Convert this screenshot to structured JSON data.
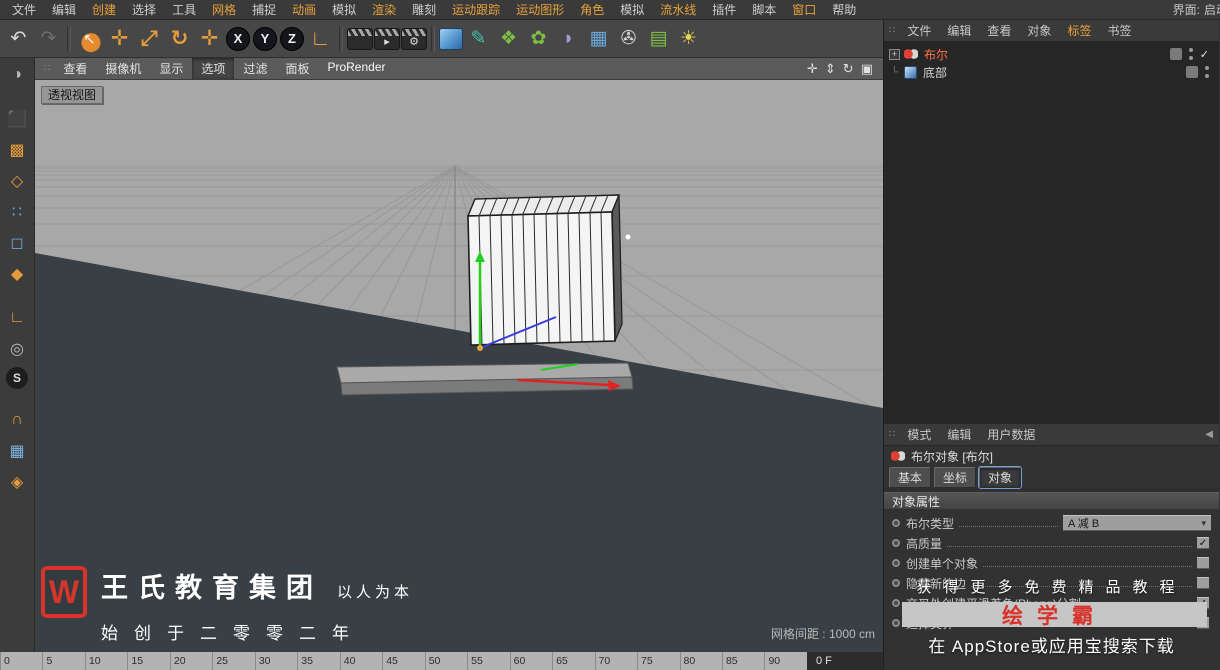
{
  "colors": {
    "accent_orange": "#e8a23b",
    "boole_text": "#ff7043",
    "brand_red": "#d6352b",
    "axis_x": "#e02222",
    "axis_y": "#21cf21",
    "axis_z": "#3b3be0"
  },
  "glyphs": {
    "plus": "+",
    "collapse": "◀",
    "check": "✓",
    "dropdown_arrow": "▾",
    "handle": "∷",
    "tree_child": "└"
  },
  "menubar": {
    "items": [
      {
        "label": "文件",
        "cls": ""
      },
      {
        "label": "编辑",
        "cls": ""
      },
      {
        "label": "创建",
        "cls": "accent"
      },
      {
        "label": "选择",
        "cls": ""
      },
      {
        "label": "工具",
        "cls": ""
      },
      {
        "label": "网格",
        "cls": "accent"
      },
      {
        "label": "捕捉",
        "cls": ""
      },
      {
        "label": "动画",
        "cls": "accent"
      },
      {
        "label": "模拟",
        "cls": ""
      },
      {
        "label": "渲染",
        "cls": "accent"
      },
      {
        "label": "雕刻",
        "cls": ""
      },
      {
        "label": "运动跟踪",
        "cls": "accent"
      },
      {
        "label": "运动图形",
        "cls": "accent"
      },
      {
        "label": "角色",
        "cls": "accent"
      },
      {
        "label": "模拟",
        "cls": ""
      },
      {
        "label": "流水线",
        "cls": "accent"
      },
      {
        "label": "插件",
        "cls": ""
      },
      {
        "label": "脚本",
        "cls": ""
      },
      {
        "label": "窗口",
        "cls": "accent"
      },
      {
        "label": "帮助",
        "cls": ""
      }
    ],
    "interface_label": "界面:",
    "interface_value": "启动"
  },
  "toolbar": {
    "tools": [
      {
        "name": "undo-icon",
        "glyph": "↶",
        "cls": "t-light"
      },
      {
        "name": "redo-icon",
        "glyph": "↷",
        "cls": "t-dim"
      },
      {
        "name": "separator",
        "glyph": "",
        "cls": "sep"
      },
      {
        "name": "live-selection-icon",
        "glyph": "↖",
        "cls": "t-select"
      },
      {
        "name": "move-tool-icon",
        "glyph": "✛",
        "cls": "t-accent"
      },
      {
        "name": "scale-tool-icon",
        "glyph": "⤢",
        "cls": "t-accent"
      },
      {
        "name": "rotate-tool-icon",
        "glyph": "↻",
        "cls": "t-accent"
      },
      {
        "name": "recent-tool-icon",
        "glyph": "✛",
        "cls": "t-accent"
      },
      {
        "name": "x-axis-lock-icon",
        "glyph": "X",
        "cls": "t-axis"
      },
      {
        "name": "y-axis-lock-icon",
        "glyph": "Y",
        "cls": "t-axis"
      },
      {
        "name": "z-axis-lock-icon",
        "glyph": "Z",
        "cls": "t-axis"
      },
      {
        "name": "coord-system-icon",
        "glyph": "∟",
        "cls": "t-accent"
      },
      {
        "name": "separator",
        "glyph": "",
        "cls": "sep"
      },
      {
        "name": "render-view-icon",
        "glyph": "",
        "cls": "t-clapper"
      },
      {
        "name": "render-picture-viewer-icon",
        "glyph": "▸",
        "cls": "t-clapper"
      },
      {
        "name": "render-settings-icon",
        "glyph": "⚙",
        "cls": "t-clapper"
      },
      {
        "name": "separator",
        "glyph": "",
        "cls": "sep"
      },
      {
        "name": "cube-primitive-icon",
        "glyph": "",
        "cls": "t-cube"
      },
      {
        "name": "spline-pen-icon",
        "glyph": "✎",
        "cls": "t-teal"
      },
      {
        "name": "mograph-cloner-icon",
        "glyph": "❖",
        "cls": "t-green"
      },
      {
        "name": "field-icon",
        "glyph": "✿",
        "cls": "t-green"
      },
      {
        "name": "deformer-icon",
        "glyph": "◗",
        "cls": "t-purple"
      },
      {
        "name": "volume-icon",
        "glyph": "▦",
        "cls": "t-blue"
      },
      {
        "name": "camera-icon",
        "glyph": "✇",
        "cls": "t-light"
      },
      {
        "name": "display-toggle-icon",
        "glyph": "▤",
        "cls": "t-green"
      },
      {
        "name": "light-icon",
        "glyph": "☀",
        "cls": "t-yellow"
      }
    ]
  },
  "left_toolbar": {
    "tools": [
      {
        "name": "make-editable-icon",
        "glyph": "◑",
        "cls": "li-gray"
      },
      {
        "name": "model-mode-icon",
        "glyph": "⬛",
        "cls": "li-blue gap"
      },
      {
        "name": "texture-mode-icon",
        "glyph": "▩",
        "cls": "li-orange"
      },
      {
        "name": "workplane-mode-icon",
        "glyph": "◇",
        "cls": "li-orange"
      },
      {
        "name": "points-mode-icon",
        "glyph": "∷",
        "cls": "li-blue"
      },
      {
        "name": "edges-mode-icon",
        "glyph": "◻",
        "cls": "li-blue"
      },
      {
        "name": "polygons-mode-icon",
        "glyph": "◆",
        "cls": "li-orange"
      },
      {
        "name": "axis-mode-icon",
        "glyph": "∟",
        "cls": "li-orange gap"
      },
      {
        "name": "viewport-solo-icon",
        "glyph": "◎",
        "cls": "li-gray"
      },
      {
        "name": "simulation-icon",
        "glyph": "S",
        "cls": "li-dark"
      },
      {
        "name": "snap-enable-icon",
        "glyph": "∩",
        "cls": "li-orange gap"
      },
      {
        "name": "quantize-icon",
        "glyph": "▦",
        "cls": "li-blue2"
      },
      {
        "name": "workplane-snap-icon",
        "glyph": "◈",
        "cls": "li-orange"
      }
    ]
  },
  "viewport_menu": {
    "items": [
      {
        "label": "查看",
        "cls": ""
      },
      {
        "label": "摄像机",
        "cls": ""
      },
      {
        "label": "显示",
        "cls": ""
      },
      {
        "label": "选项",
        "cls": "active"
      },
      {
        "label": "过滤",
        "cls": ""
      },
      {
        "label": "面板",
        "cls": ""
      },
      {
        "label": "ProRender",
        "cls": "strong"
      }
    ],
    "nav": [
      {
        "name": "pan-view-icon",
        "glyph": "✛"
      },
      {
        "name": "zoom-view-icon",
        "glyph": "⇕"
      },
      {
        "name": "rotate-view-icon",
        "glyph": "↻"
      },
      {
        "name": "toggle-view-icon",
        "glyph": "▣"
      }
    ]
  },
  "viewport": {
    "view_label": "透视视图",
    "grid_label": "网格间距 : 1000 cm"
  },
  "watermark": {
    "logo_letter": "W",
    "brand": "王氏教育集团",
    "slogan": "以人为本",
    "line2": "始创于二零零二年"
  },
  "object_manager": {
    "menu": [
      {
        "label": "文件",
        "cls": ""
      },
      {
        "label": "编辑",
        "cls": ""
      },
      {
        "label": "查看",
        "cls": ""
      },
      {
        "label": "对象",
        "cls": ""
      },
      {
        "label": "标签",
        "cls": "accent"
      },
      {
        "label": "书签",
        "cls": ""
      }
    ],
    "objects": [
      {
        "name": "布尔"
      },
      {
        "name": "底部"
      }
    ]
  },
  "attribute_manager": {
    "menu": [
      {
        "label": "模式",
        "cls": ""
      },
      {
        "label": "编辑",
        "cls": ""
      },
      {
        "label": "用户数据",
        "cls": ""
      }
    ],
    "title": "布尔对象 [布尔]",
    "tabs": [
      {
        "label": "基本",
        "cls": ""
      },
      {
        "label": "坐标",
        "cls": ""
      },
      {
        "label": "对象",
        "cls": "active"
      }
    ],
    "section": "对象属性",
    "props": [
      {
        "label": "布尔类型",
        "value": "A 减 B"
      },
      {
        "label": "高质量",
        "checked": true
      },
      {
        "label": "创建单个对象",
        "checked": false
      },
      {
        "label": "隐藏新的边",
        "checked": false
      },
      {
        "label": "交叉处创建平滑着色(Phong)分割",
        "checked": true
      },
      {
        "label": "选择交界",
        "checked": false
      }
    ]
  },
  "ad": {
    "line1": "获得更多免费精品教程",
    "brand": "绘学霸",
    "line2": "在 AppStore或应用宝搜索下载"
  },
  "timeline": {
    "ticks": [
      "0",
      "5",
      "10",
      "15",
      "20",
      "25",
      "30",
      "35",
      "40",
      "45",
      "50",
      "55",
      "60",
      "65",
      "70",
      "75",
      "80",
      "85",
      "90"
    ],
    "frame": "0 F"
  }
}
